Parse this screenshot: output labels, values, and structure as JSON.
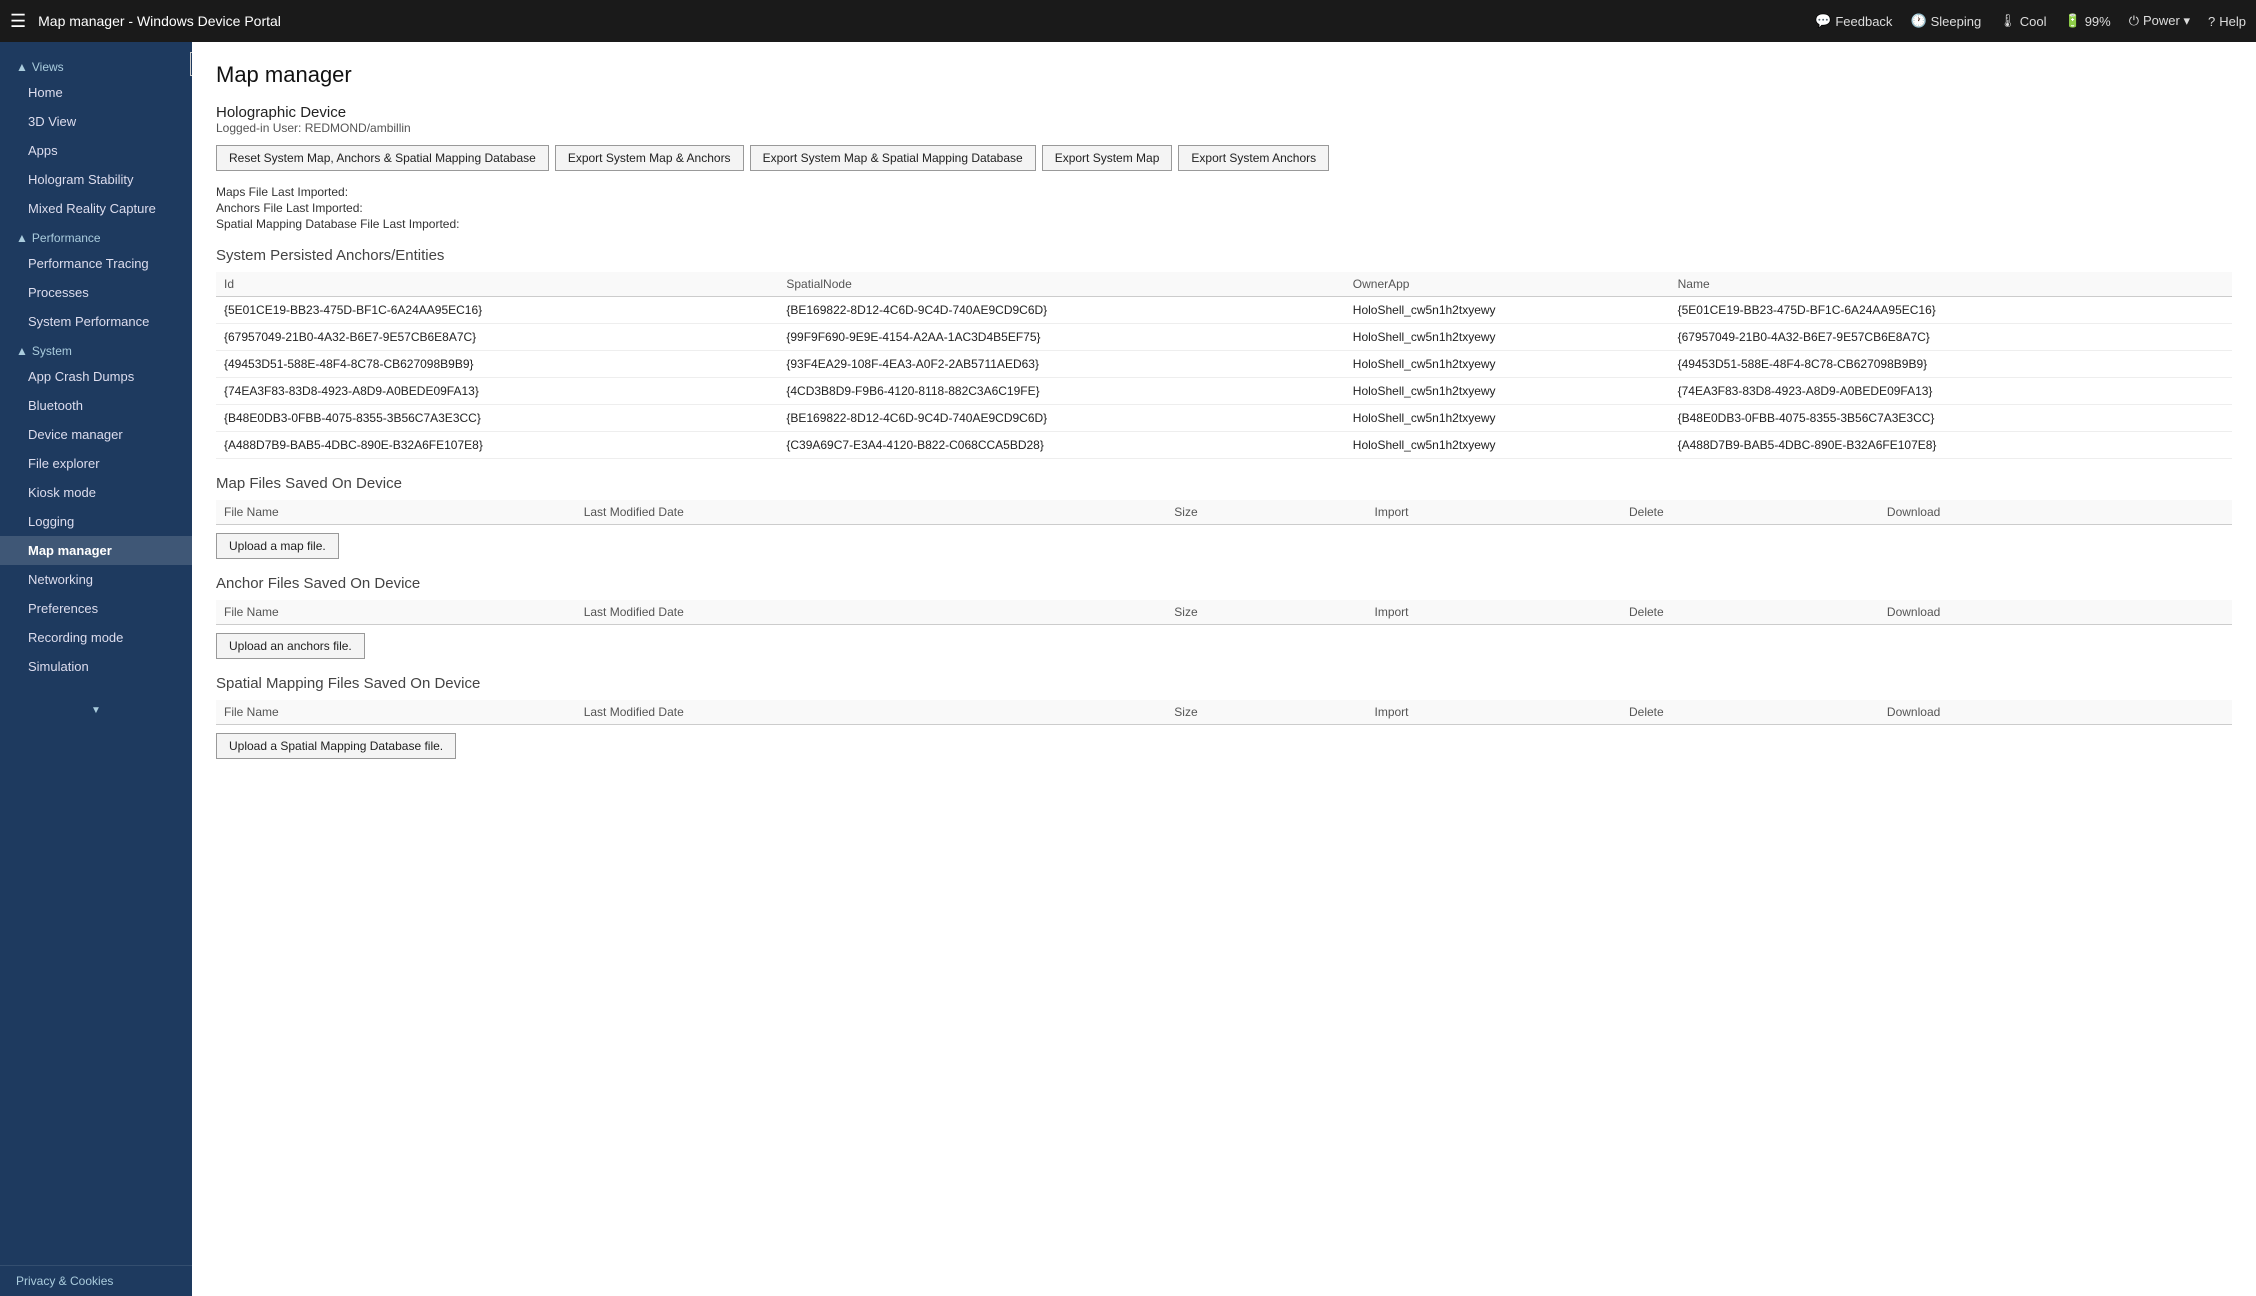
{
  "topbar": {
    "hamburger": "☰",
    "title": "Map manager - Windows Device Portal",
    "actions": [
      {
        "id": "feedback",
        "icon": "💬",
        "label": "Feedback"
      },
      {
        "id": "sleeping",
        "icon": "🕐",
        "label": "Sleeping"
      },
      {
        "id": "cool",
        "icon": "🌡",
        "label": "Cool"
      },
      {
        "id": "battery",
        "icon": "🔋",
        "label": "99%"
      },
      {
        "id": "power",
        "icon": "⏻",
        "label": "Power ▾"
      },
      {
        "id": "help",
        "icon": "?",
        "label": "Help"
      }
    ]
  },
  "sidebar": {
    "collapse_icon": "◀",
    "views_header": "▲Views",
    "views_items": [
      "Home",
      "3D View",
      "Apps",
      "Hologram Stability",
      "Mixed Reality Capture"
    ],
    "performance_header": "▲Performance",
    "performance_items": [
      "Performance Tracing",
      "Processes",
      "System Performance"
    ],
    "system_header": "▲System",
    "system_items": [
      "App Crash Dumps",
      "Bluetooth",
      "Device manager",
      "File explorer",
      "Kiosk mode",
      "Logging",
      "Map manager",
      "Networking",
      "Preferences",
      "Recording mode",
      "Simulation"
    ],
    "bottom": "Privacy & Cookies"
  },
  "main": {
    "title": "Map manager",
    "device": {
      "name": "Holographic Device",
      "logged_in": "Logged-in User: REDMOND/ambillin"
    },
    "buttons": [
      "Reset System Map, Anchors & Spatial Mapping Database",
      "Export System Map & Anchors",
      "Export System Map & Spatial Mapping Database",
      "Export System Map",
      "Export System Anchors"
    ],
    "file_info": [
      "Maps File Last Imported:",
      "Anchors File Last Imported:",
      "Spatial Mapping Database File Last Imported:"
    ],
    "anchors_section": {
      "title": "System Persisted Anchors/Entities",
      "columns": [
        "Id",
        "SpatialNode",
        "OwnerApp",
        "Name"
      ],
      "rows": [
        {
          "id": "{5E01CE19-BB23-475D-BF1C-6A24AA95EC16}",
          "spatial_node": "{BE169822-8D12-4C6D-9C4D-740AE9CD9C6D}",
          "owner_app": "HoloShell_cw5n1h2txyewy",
          "name": "{5E01CE19-BB23-475D-BF1C-6A24AA95EC16}"
        },
        {
          "id": "{67957049-21B0-4A32-B6E7-9E57CB6E8A7C}",
          "spatial_node": "{99F9F690-9E9E-4154-A2AA-1AC3D4B5EF75}",
          "owner_app": "HoloShell_cw5n1h2txyewy",
          "name": "{67957049-21B0-4A32-B6E7-9E57CB6E8A7C}"
        },
        {
          "id": "{49453D51-588E-48F4-8C78-CB627098B9B9}",
          "spatial_node": "{93F4EA29-108F-4EA3-A0F2-2AB5711AED63}",
          "owner_app": "HoloShell_cw5n1h2txyewy",
          "name": "{49453D51-588E-48F4-8C78-CB627098B9B9}"
        },
        {
          "id": "{74EA3F83-83D8-4923-A8D9-A0BEDE09FA13}",
          "spatial_node": "{4CD3B8D9-F9B6-4120-8118-882C3A6C19FE}",
          "owner_app": "HoloShell_cw5n1h2txyewy",
          "name": "{74EA3F83-83D8-4923-A8D9-A0BEDE09FA13}"
        },
        {
          "id": "{B48E0DB3-0FBB-4075-8355-3B56C7A3E3CC}",
          "spatial_node": "{BE169822-8D12-4C6D-9C4D-740AE9CD9C6D}",
          "owner_app": "HoloShell_cw5n1h2txyewy",
          "name": "{B48E0DB3-0FBB-4075-8355-3B56C7A3E3CC}"
        },
        {
          "id": "{A488D7B9-BAB5-4DBC-890E-B32A6FE107E8}",
          "spatial_node": "{C39A69C7-E3A4-4120-B822-C068CCA5BD28}",
          "owner_app": "HoloShell_cw5n1h2txyewy",
          "name": "{A488D7B9-BAB5-4DBC-890E-B32A6FE107E8}"
        }
      ]
    },
    "map_files": {
      "title": "Map Files Saved On Device",
      "columns": [
        "File Name",
        "Last Modified Date",
        "Size",
        "Import",
        "Delete",
        "Download"
      ],
      "upload_btn": "Upload a map file."
    },
    "anchor_files": {
      "title": "Anchor Files Saved On Device",
      "columns": [
        "File Name",
        "Last Modified Date",
        "Size",
        "Import",
        "Delete",
        "Download"
      ],
      "upload_btn": "Upload an anchors file."
    },
    "spatial_files": {
      "title": "Spatial Mapping Files Saved On Device",
      "columns": [
        "File Name",
        "Last Modified Date",
        "Size",
        "Import",
        "Delete",
        "Download"
      ],
      "upload_btn": "Upload a Spatial Mapping Database file."
    }
  },
  "bottombar": {
    "label": "Privacy & Cookies"
  }
}
